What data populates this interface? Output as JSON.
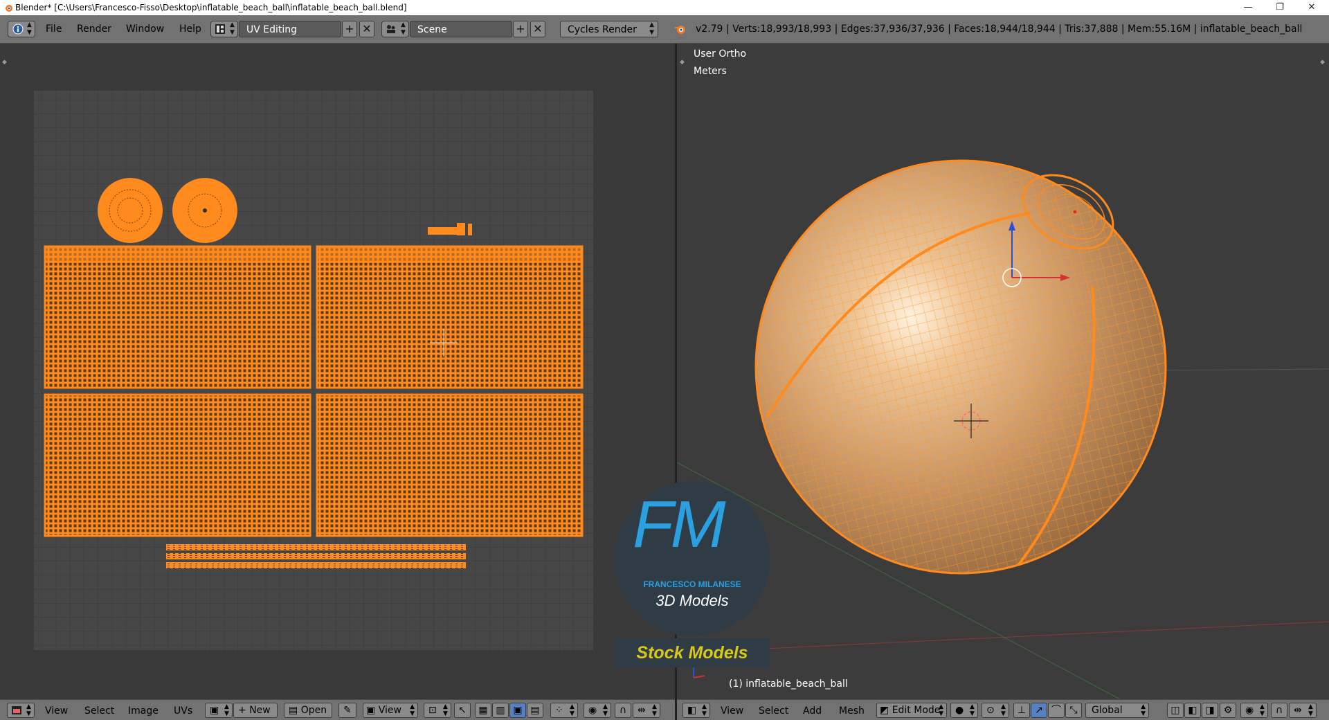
{
  "titlebar": {
    "title": "Blender* [C:\\Users\\Francesco-Fisso\\Desktop\\inflatable_beach_ball\\inflatable_beach_ball.blend]",
    "minimize": "—",
    "maximize": "❐",
    "close": "✕"
  },
  "info_header": {
    "menus": [
      "File",
      "Render",
      "Window",
      "Help"
    ],
    "screen_layout": "UV Editing",
    "scene": "Scene",
    "render_engine": "Cycles Render",
    "stats": "v2.79 | Verts:18,993/18,993 | Edges:37,936/37,936 | Faces:18,944/18,944 | Tris:37,888 | Mem:55.16M | inflatable_beach_ball"
  },
  "uv_editor": {
    "footer": {
      "menus": [
        "View",
        "Select",
        "Image",
        "UVs"
      ],
      "new_label": "New",
      "open_label": "Open",
      "view_label": "View"
    }
  },
  "viewport": {
    "view_name": "User Ortho",
    "units": "Meters",
    "object_label": "(1) inflatable_beach_ball",
    "footer": {
      "menus": [
        "View",
        "Select",
        "Add",
        "Mesh"
      ],
      "mode": "Edit Mode",
      "orientation": "Global"
    }
  },
  "watermark": {
    "letters": "FM",
    "name": "FRANCESCO MILANESE",
    "sub": "3D Models",
    "banner": "Stock Models"
  },
  "colors": {
    "accent": "#ff8a1e",
    "ui_header": "#727272",
    "ui_bg": "#393939"
  }
}
